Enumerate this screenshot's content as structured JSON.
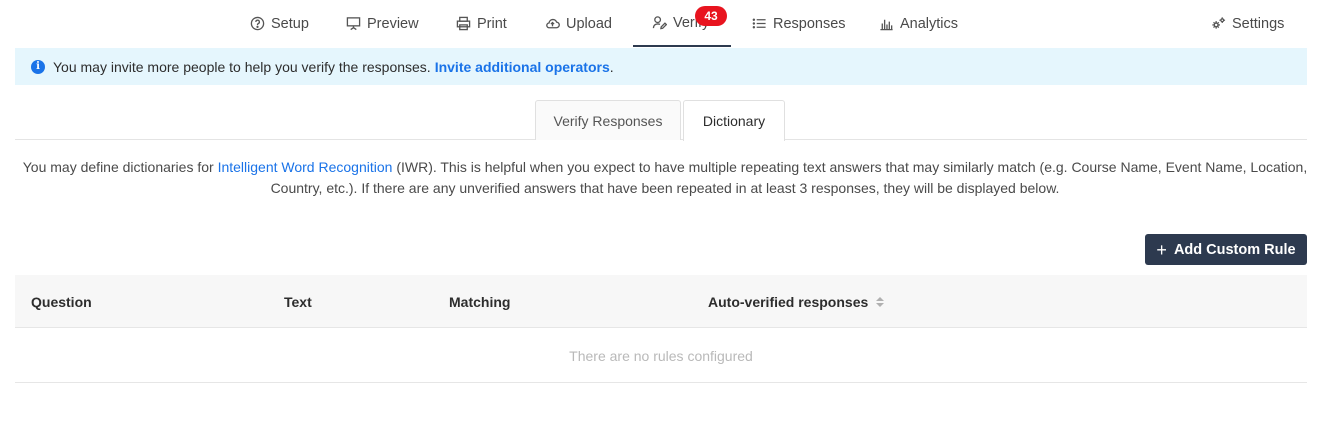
{
  "nav": {
    "items": [
      {
        "label": "Setup",
        "icon": "question-circle-icon"
      },
      {
        "label": "Preview",
        "icon": "presentation-icon"
      },
      {
        "label": "Print",
        "icon": "printer-icon"
      },
      {
        "label": "Upload",
        "icon": "cloud-upload-icon"
      },
      {
        "label": "Verify",
        "icon": "user-edit-icon",
        "active": true
      },
      {
        "label": "Responses",
        "icon": "list-icon"
      },
      {
        "label": "Analytics",
        "icon": "bar-chart-icon"
      }
    ],
    "verify_badge": "43",
    "settings_label": "Settings"
  },
  "banner": {
    "text": "You may invite more people to help you verify the responses.",
    "link": "Invite additional operators",
    "suffix": "."
  },
  "tabs": [
    {
      "label": "Verify Responses",
      "active": false
    },
    {
      "label": "Dictionary",
      "active": true
    }
  ],
  "description": {
    "prefix": "You may define dictionaries for",
    "link": "Intelligent Word Recognition",
    "suffix": "(IWR). This is helpful when you expect to have multiple repeating text answers that may similarly match (e.g. Course Name, Event Name, Location, Country, etc.). If there are any unverified answers that have been repeated in at least 3 responses, they will be displayed below."
  },
  "add_rule_label": "Add Custom Rule",
  "table": {
    "columns": [
      "Question",
      "Text",
      "Matching",
      "Auto-verified responses"
    ],
    "empty_message": "There are no rules configured"
  },
  "colors": {
    "accent": "#1a73e8",
    "primary_button": "#2d3a4f",
    "badge": "#e8141f",
    "banner_bg": "#e5f6fd"
  }
}
